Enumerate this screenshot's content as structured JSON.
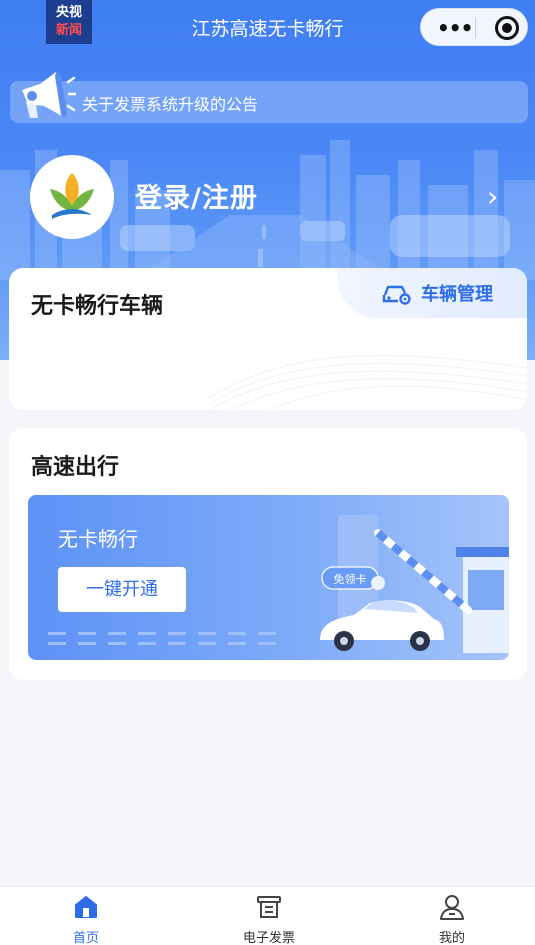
{
  "watermark": {
    "line1": "央视",
    "line2": "新闻"
  },
  "header": {
    "title": "江苏高速无卡畅行"
  },
  "capsule": {
    "more_icon": "more-dots-icon",
    "close_icon": "target-close-icon"
  },
  "notice": {
    "icon": "megaphone-icon",
    "text": "关于发票系统升级的公告"
  },
  "profile": {
    "avatar_icon": "leaf-logo-icon",
    "login_label": "登录/注册",
    "arrow": "›"
  },
  "vehicles_card": {
    "title": "无卡畅行车辆",
    "manage_label": "车辆管理",
    "manage_icon": "car-settings-icon"
  },
  "travel_card": {
    "title": "高速出行",
    "banner": {
      "title": "无卡畅行",
      "button_label": "一键开通",
      "bubble_text": "免领卡"
    }
  },
  "tabbar": {
    "items": [
      {
        "label": "首页",
        "icon": "home-icon",
        "active": true
      },
      {
        "label": "电子发票",
        "icon": "invoice-icon",
        "active": false
      },
      {
        "label": "我的",
        "icon": "user-icon",
        "active": false
      }
    ]
  },
  "colors": {
    "primary": "#2f6de8",
    "hero": "#4b88f5",
    "page_bg": "#f4f5f8"
  }
}
